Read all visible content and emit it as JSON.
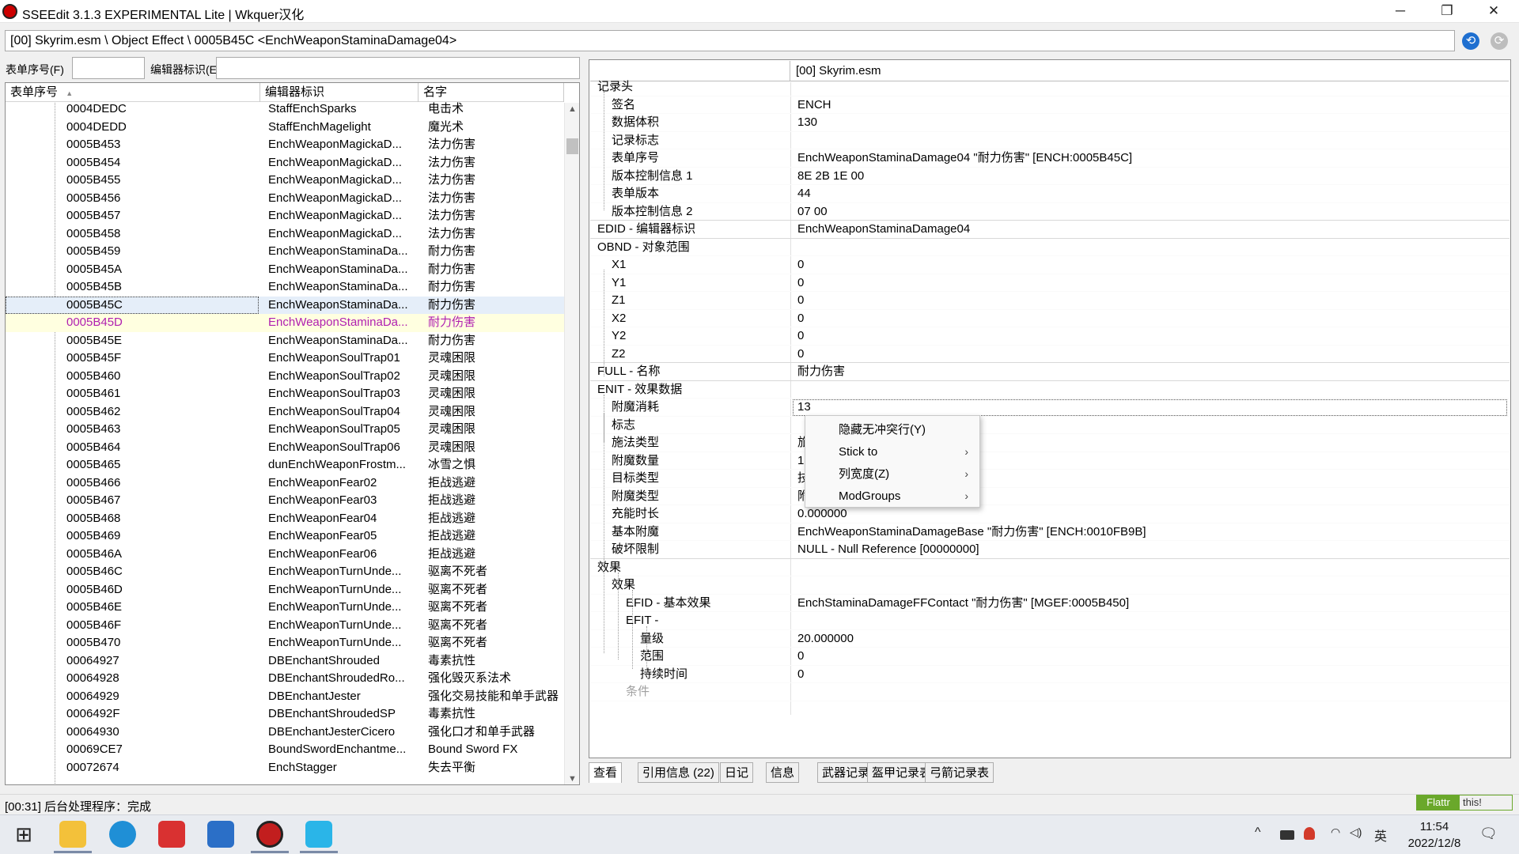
{
  "window": {
    "title": "SSEEdit 3.1.3 EXPERIMENTAL Lite  | Wkquer汉化",
    "minimize_glyph": "─",
    "restore_glyph": "❐",
    "close_glyph": "✕"
  },
  "pathbar": {
    "path": "[00] Skyrim.esm \\ Object Effect \\ 0005B45C <EnchWeaponStaminaDamage04>",
    "back_glyph": "⟲",
    "forward_glyph": "⟳"
  },
  "filters": {
    "formid_label": "表单序号(F)",
    "formid_value": "",
    "editorid_label": "编辑器标识(E)",
    "editorid_value": ""
  },
  "record_list": {
    "headers": [
      "表单序号",
      "编辑器标识",
      "名字"
    ],
    "sort_glyph": "▲",
    "rows": [
      {
        "formid": "0004DEDC",
        "edid": "StaffEnchSparks",
        "name": "电击术"
      },
      {
        "formid": "0004DEDD",
        "edid": "StaffEnchMagelight",
        "name": "魔光术"
      },
      {
        "formid": "0005B453",
        "edid": "EnchWeaponMagickaD...",
        "name": "法力伤害"
      },
      {
        "formid": "0005B454",
        "edid": "EnchWeaponMagickaD...",
        "name": "法力伤害"
      },
      {
        "formid": "0005B455",
        "edid": "EnchWeaponMagickaD...",
        "name": "法力伤害"
      },
      {
        "formid": "0005B456",
        "edid": "EnchWeaponMagickaD...",
        "name": "法力伤害"
      },
      {
        "formid": "0005B457",
        "edid": "EnchWeaponMagickaD...",
        "name": "法力伤害"
      },
      {
        "formid": "0005B458",
        "edid": "EnchWeaponMagickaD...",
        "name": "法力伤害"
      },
      {
        "formid": "0005B459",
        "edid": "EnchWeaponStaminaDa...",
        "name": "耐力伤害"
      },
      {
        "formid": "0005B45A",
        "edid": "EnchWeaponStaminaDa...",
        "name": "耐力伤害"
      },
      {
        "formid": "0005B45B",
        "edid": "EnchWeaponStaminaDa...",
        "name": "耐力伤害"
      },
      {
        "formid": "0005B45C",
        "edid": "EnchWeaponStaminaDa...",
        "name": "耐力伤害"
      },
      {
        "formid": "0005B45D",
        "edid": "EnchWeaponStaminaDa...",
        "name": "耐力伤害"
      },
      {
        "formid": "0005B45E",
        "edid": "EnchWeaponStaminaDa...",
        "name": "耐力伤害"
      },
      {
        "formid": "0005B45F",
        "edid": "EnchWeaponSoulTrap01",
        "name": "灵魂困限"
      },
      {
        "formid": "0005B460",
        "edid": "EnchWeaponSoulTrap02",
        "name": "灵魂困限"
      },
      {
        "formid": "0005B461",
        "edid": "EnchWeaponSoulTrap03",
        "name": "灵魂困限"
      },
      {
        "formid": "0005B462",
        "edid": "EnchWeaponSoulTrap04",
        "name": "灵魂困限"
      },
      {
        "formid": "0005B463",
        "edid": "EnchWeaponSoulTrap05",
        "name": "灵魂困限"
      },
      {
        "formid": "0005B464",
        "edid": "EnchWeaponSoulTrap06",
        "name": "灵魂困限"
      },
      {
        "formid": "0005B465",
        "edid": "dunEnchWeaponFrostm...",
        "name": "冰雪之惧"
      },
      {
        "formid": "0005B466",
        "edid": "EnchWeaponFear02",
        "name": "拒战逃避"
      },
      {
        "formid": "0005B467",
        "edid": "EnchWeaponFear03",
        "name": "拒战逃避"
      },
      {
        "formid": "0005B468",
        "edid": "EnchWeaponFear04",
        "name": "拒战逃避"
      },
      {
        "formid": "0005B469",
        "edid": "EnchWeaponFear05",
        "name": "拒战逃避"
      },
      {
        "formid": "0005B46A",
        "edid": "EnchWeaponFear06",
        "name": "拒战逃避"
      },
      {
        "formid": "0005B46C",
        "edid": "EnchWeaponTurnUnde...",
        "name": "驱离不死者"
      },
      {
        "formid": "0005B46D",
        "edid": "EnchWeaponTurnUnde...",
        "name": "驱离不死者"
      },
      {
        "formid": "0005B46E",
        "edid": "EnchWeaponTurnUnde...",
        "name": "驱离不死者"
      },
      {
        "formid": "0005B46F",
        "edid": "EnchWeaponTurnUnde...",
        "name": "驱离不死者"
      },
      {
        "formid": "0005B470",
        "edid": "EnchWeaponTurnUnde...",
        "name": "驱离不死者"
      },
      {
        "formid": "00064927",
        "edid": "DBEnchantShrouded",
        "name": "毒素抗性"
      },
      {
        "formid": "00064928",
        "edid": "DBEnchantShroudedRo...",
        "name": "强化毁灭系法术"
      },
      {
        "formid": "00064929",
        "edid": "DBEnchantJester",
        "name": "强化交易技能和单手武器"
      },
      {
        "formid": "0006492F",
        "edid": "DBEnchantShroudedSP",
        "name": "毒素抗性"
      },
      {
        "formid": "00064930",
        "edid": "DBEnchantJesterCicero",
        "name": "强化口才和单手武器"
      },
      {
        "formid": "00069CE7",
        "edid": "BoundSwordEnchantme...",
        "name": "Bound Sword FX"
      },
      {
        "formid": "00072674",
        "edid": "EnchStagger",
        "name": "失去平衡"
      }
    ]
  },
  "record_view": {
    "column_header": "[00] Skyrim.esm",
    "rows": [
      {
        "key": "记录头",
        "value": ""
      },
      {
        "key": "签名",
        "value": "ENCH"
      },
      {
        "key": "数据体积",
        "value": "130"
      },
      {
        "key": "记录标志",
        "value": ""
      },
      {
        "key": "表单序号",
        "value": "EnchWeaponStaminaDamage04 \"耐力伤害\" [ENCH:0005B45C]"
      },
      {
        "key": "版本控制信息 1",
        "value": "8E 2B 1E 00"
      },
      {
        "key": "表单版本",
        "value": "44"
      },
      {
        "key": "版本控制信息 2",
        "value": "07 00"
      },
      {
        "key": "EDID - 编辑器标识",
        "value": "EnchWeaponStaminaDamage04"
      },
      {
        "key": "OBND - 对象范围",
        "value": ""
      },
      {
        "key": "X1",
        "value": "0"
      },
      {
        "key": "Y1",
        "value": "0"
      },
      {
        "key": "Z1",
        "value": "0"
      },
      {
        "key": "X2",
        "value": "0"
      },
      {
        "key": "Y2",
        "value": "0"
      },
      {
        "key": "Z2",
        "value": "0"
      },
      {
        "key": "FULL - 名称",
        "value": "耐力伤害"
      },
      {
        "key": "ENIT - 效果数据",
        "value": ""
      },
      {
        "key": "附魔消耗",
        "value": "13"
      },
      {
        "key": "标志",
        "value": ""
      },
      {
        "key": "施法类型",
        "value": "旅"
      },
      {
        "key": "附魔数量",
        "value": "1"
      },
      {
        "key": "目标类型",
        "value": "技"
      },
      {
        "key": "附魔类型",
        "value": "附"
      },
      {
        "key": "充能时长",
        "value": "0.000000"
      },
      {
        "key": "基本附魔",
        "value": "EnchWeaponStaminaDamageBase \"耐力伤害\" [ENCH:0010FB9B]"
      },
      {
        "key": "破坏限制",
        "value": "NULL - Null Reference [00000000]"
      },
      {
        "key": "效果",
        "value": ""
      },
      {
        "key": "效果",
        "value": ""
      },
      {
        "key": "EFID - 基本效果",
        "value": "EnchStaminaDamageFFContact \"耐力伤害\" [MGEF:0005B450]"
      },
      {
        "key": "EFIT - ",
        "value": ""
      },
      {
        "key": "量级",
        "value": "20.000000"
      },
      {
        "key": "范围",
        "value": "0"
      },
      {
        "key": "持续时间",
        "value": "0"
      },
      {
        "key": "条件",
        "value": ""
      }
    ]
  },
  "context_menu": {
    "items": [
      {
        "label": "隐藏无冲突行(Y)",
        "submenu": ""
      },
      {
        "label": "Stick to",
        "submenu": "›"
      },
      {
        "label": "列宽度(Z)",
        "submenu": "›"
      },
      {
        "label": "ModGroups",
        "submenu": "›"
      }
    ]
  },
  "tabs": [
    "查看",
    "引用信息 (22)",
    "日记",
    "信息",
    "武器记录表",
    "盔甲记录表",
    "弓箭记录表"
  ],
  "status": {
    "text": "[00:31] 后台处理程序：完成",
    "flattr_a": "Flattr",
    "flattr_b": "this!"
  },
  "taskbar": {
    "start_glyph": "⊞",
    "apps": [
      "file-explorer",
      "edge",
      "wps",
      "game-controller",
      "sseedit",
      "notes"
    ],
    "tray_ime": "英",
    "clock_time": "11:54",
    "clock_date": "2022/12/8",
    "chevron": "^",
    "notification_glyph": "🗨"
  },
  "colors": {
    "accent": "#1e6fd0",
    "selection": "#e5eef9",
    "highlight_bg": "#ffffe0",
    "highlight_text": "#b01fb0",
    "flattr_green": "#6aa82b"
  }
}
